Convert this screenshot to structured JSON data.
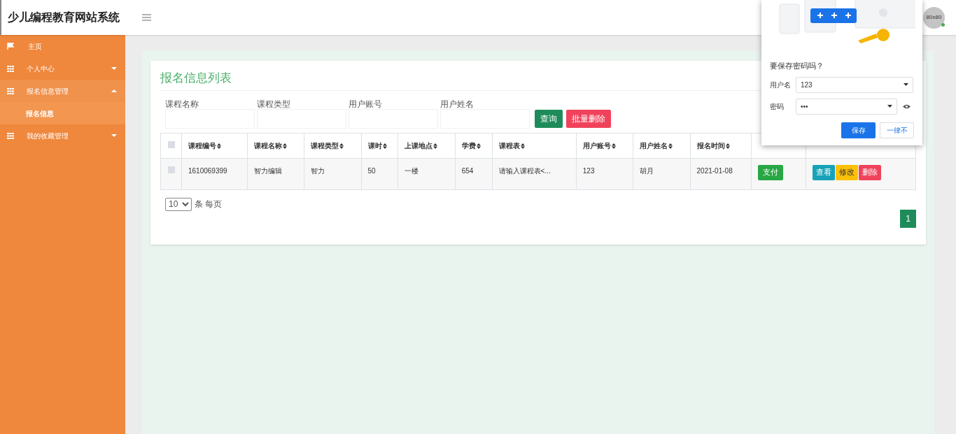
{
  "header": {
    "title": "少儿编程教育网站系统",
    "avatar_text": "80x80",
    "online": true
  },
  "sidebar": {
    "items": [
      {
        "label": "主页",
        "kind": "flag",
        "expanded": false,
        "selected": false,
        "has_caret": false
      },
      {
        "label": "个人中心",
        "kind": "grid",
        "expanded": false,
        "selected": false,
        "has_caret": true
      },
      {
        "label": "报名信息管理",
        "kind": "grid",
        "expanded": true,
        "selected": true,
        "has_caret": true,
        "children": [
          {
            "label": "报名信息",
            "selected": true
          }
        ]
      },
      {
        "label": "我的收藏管理",
        "kind": "grid",
        "expanded": false,
        "selected": false,
        "has_caret": true
      }
    ]
  },
  "page": {
    "title": "报名信息列表",
    "select_all_checked": false,
    "filters": [
      {
        "label": "课程名称"
      },
      {
        "label": "课程类型"
      },
      {
        "label": "用户账号"
      },
      {
        "label": "用户姓名"
      }
    ],
    "buttons": [
      {
        "label": "查询",
        "kind": "search"
      },
      {
        "label": "批量删除",
        "kind": "delete"
      }
    ],
    "table": {
      "columns": [
        "课程编号",
        "课程名称",
        "课程类型",
        "课时",
        "上课地点",
        "学费",
        "课程表",
        "用户账号",
        "用户姓名",
        "报名时间"
      ],
      "rows": [
        {
          "checked": false,
          "cells": [
            "1610069399",
            "智力编辑",
            "智力",
            "50",
            "一楼",
            "654",
            "请输入课程表<...",
            "123",
            "胡月",
            "2021-01-08"
          ],
          "pay": "支付",
          "actions": [
            {
              "label": "查看",
              "kind": "view"
            },
            {
              "label": "修改",
              "kind": "edit"
            },
            {
              "label": "删除",
              "kind": "delete"
            }
          ]
        }
      ]
    },
    "page_size": "10",
    "page_size_suffix": "条 每页",
    "pages": [
      {
        "label": "1",
        "selected": true
      }
    ]
  },
  "popup": {
    "title": "要保存密码吗？",
    "username_label": "用户名",
    "username": "123",
    "password_label": "密码",
    "password": "•••",
    "buttons": [
      {
        "label": "保存",
        "kind": "primary"
      },
      {
        "label": "一律不",
        "kind": "secondary"
      }
    ]
  }
}
